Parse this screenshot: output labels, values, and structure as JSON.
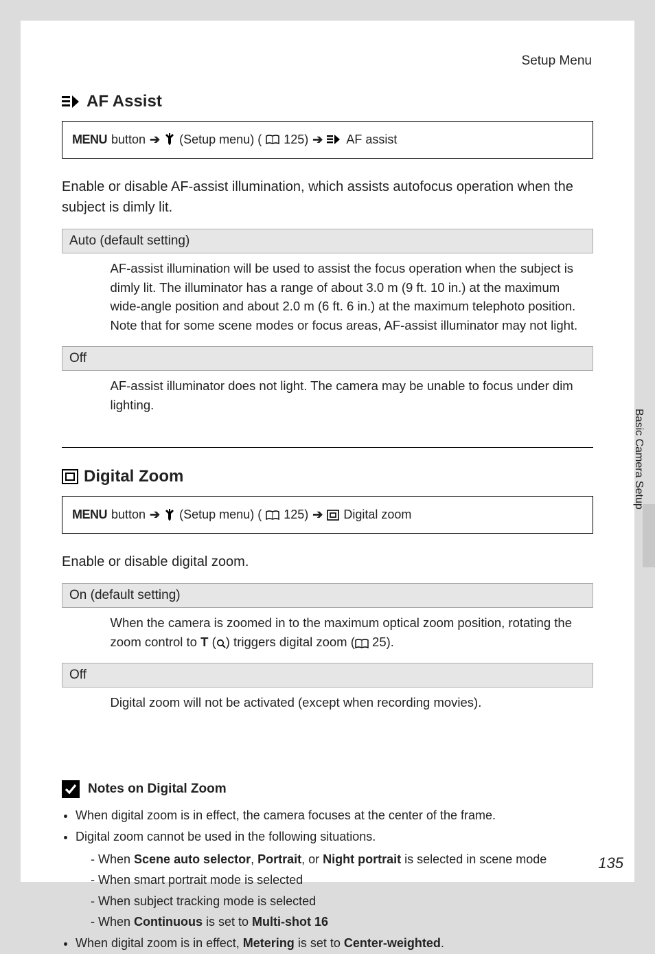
{
  "header": {
    "menuName": "Setup Menu"
  },
  "sideTab": "Basic Camera Setup",
  "pageNumber": "135",
  "section1": {
    "title": "AF Assist",
    "nav": {
      "menu": "MENU",
      "button": "button",
      "setup": "(Setup menu) (",
      "pageRef": "125)",
      "item": "AF assist"
    },
    "intro": "Enable or disable AF-assist illumination, which assists autofocus operation when the subject is dimly lit.",
    "options": [
      {
        "label": "Auto (default setting)",
        "desc": "AF-assist illumination will be used to assist the focus operation when the subject is dimly lit. The illuminator has a range of about 3.0 m (9 ft. 10 in.) at the maximum wide-angle position and about 2.0 m (6 ft. 6 in.) at the maximum telephoto position. Note that for some scene modes or focus areas, AF-assist illuminator may not light."
      },
      {
        "label": "Off",
        "desc": "AF-assist illuminator does not light. The camera may be unable to focus under dim lighting."
      }
    ]
  },
  "section2": {
    "title": "Digital Zoom",
    "nav": {
      "menu": "MENU",
      "button": "button",
      "setup": "(Setup menu) (",
      "pageRef": "125)",
      "item": "Digital zoom"
    },
    "intro": "Enable or disable digital zoom.",
    "options": [
      {
        "label": "On (default setting)",
        "descA": "When the camera is zoomed in to the maximum optical zoom position, rotating the zoom control to ",
        "t": "T",
        "paren1": " (",
        "paren2": ") triggers digital zoom (",
        "pageRef": "25)."
      },
      {
        "label": "Off",
        "desc": "Digital zoom will not be activated (except when recording movies)."
      }
    ]
  },
  "notes": {
    "title": "Notes on Digital Zoom",
    "items": {
      "a": "When digital zoom is in effect, the camera focuses at the center of the frame.",
      "b": "Digital zoom cannot be used in the following situations.",
      "b1a": "When ",
      "b1b": "Scene auto selector",
      "b1c": ", ",
      "b1d": "Portrait",
      "b1e": ", or ",
      "b1f": "Night portrait",
      "b1g": " is selected in scene mode",
      "b2": "When smart portrait mode is selected",
      "b3": "When subject tracking mode is selected",
      "b4a": "When ",
      "b4b": "Continuous",
      "b4c": " is set to ",
      "b4d": "Multi-shot 16",
      "c1": "When digital zoom is in effect, ",
      "c2": "Metering",
      "c3": " is set to ",
      "c4": "Center-weighted",
      "c5": "."
    }
  }
}
